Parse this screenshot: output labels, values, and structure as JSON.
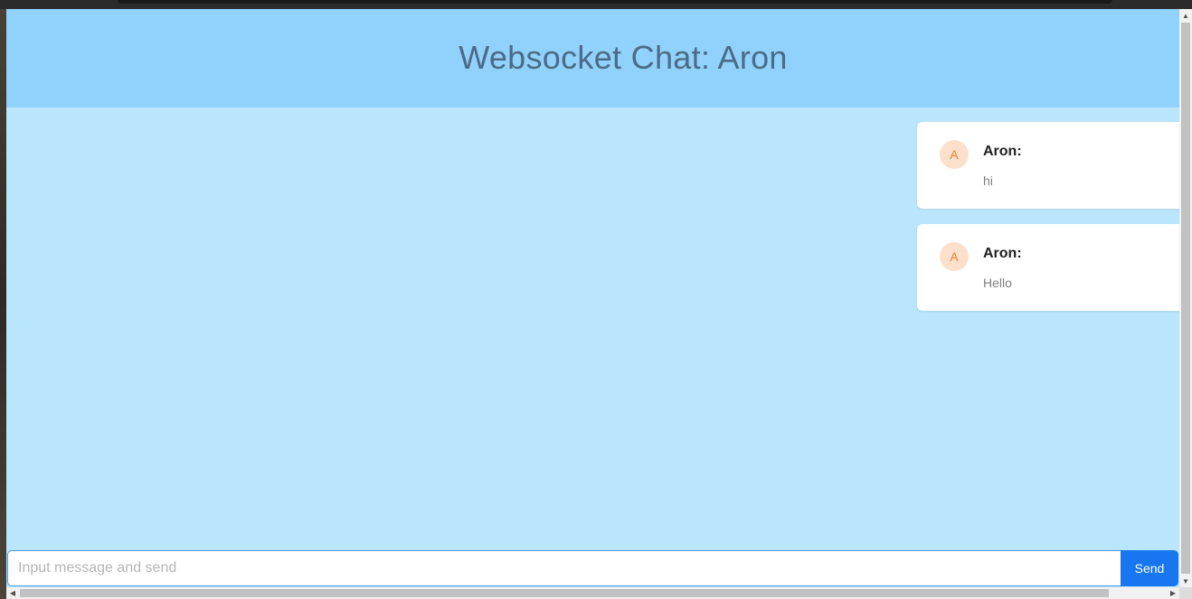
{
  "header": {
    "title": "Websocket Chat: Aron"
  },
  "messages": [
    {
      "avatar": "A",
      "author": "Aron:",
      "text": "hi"
    },
    {
      "avatar": "A",
      "author": "Aron:",
      "text": "Hello"
    }
  ],
  "composer": {
    "placeholder": "Input message and send",
    "value": "",
    "send_label": "Send"
  },
  "scrollbars": {
    "up_arrow": "▲",
    "down_arrow": "▼",
    "left_arrow": "◀",
    "right_arrow": "▶",
    "up_icon": "scroll-up-arrow-icon",
    "down_icon": "scroll-down-arrow-icon",
    "left_icon": "scroll-left-arrow-icon",
    "right_icon": "scroll-right-arrow-icon"
  },
  "colors": {
    "header_bg": "#91d2fd",
    "body_bg": "#b9e5fd",
    "title_color": "#4b6b86",
    "send_button": "#1776f0",
    "avatar_bg": "#fde0cc",
    "avatar_text": "#ef7e2a"
  }
}
